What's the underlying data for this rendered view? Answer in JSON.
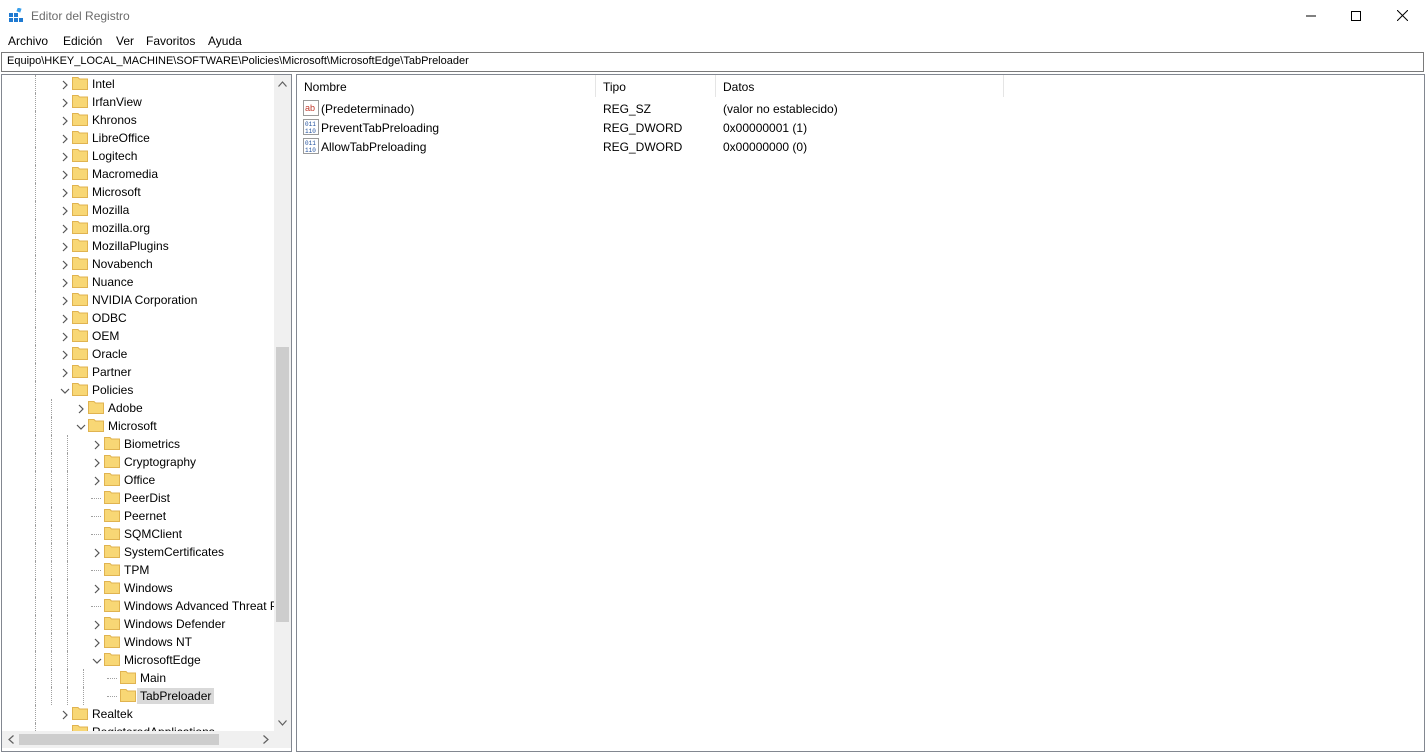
{
  "window": {
    "title": "Editor del Registro",
    "icon": "regedit-icon"
  },
  "menu": {
    "items": [
      "Archivo",
      "Edición",
      "Ver",
      "Favoritos",
      "Ayuda"
    ]
  },
  "address": {
    "path": "Equipo\\HKEY_LOCAL_MACHINE\\SOFTWARE\\Policies\\Microsoft\\MicrosoftEdge\\TabPreloader"
  },
  "tree": {
    "items": [
      {
        "label": "Intel",
        "level": 0,
        "state": "collapsed"
      },
      {
        "label": "IrfanView",
        "level": 0,
        "state": "collapsed"
      },
      {
        "label": "Khronos",
        "level": 0,
        "state": "collapsed"
      },
      {
        "label": "LibreOffice",
        "level": 0,
        "state": "collapsed"
      },
      {
        "label": "Logitech",
        "level": 0,
        "state": "collapsed"
      },
      {
        "label": "Macromedia",
        "level": 0,
        "state": "collapsed"
      },
      {
        "label": "Microsoft",
        "level": 0,
        "state": "collapsed"
      },
      {
        "label": "Mozilla",
        "level": 0,
        "state": "collapsed"
      },
      {
        "label": "mozilla.org",
        "level": 0,
        "state": "collapsed"
      },
      {
        "label": "MozillaPlugins",
        "level": 0,
        "state": "collapsed"
      },
      {
        "label": "Novabench",
        "level": 0,
        "state": "collapsed"
      },
      {
        "label": "Nuance",
        "level": 0,
        "state": "collapsed"
      },
      {
        "label": "NVIDIA Corporation",
        "level": 0,
        "state": "collapsed"
      },
      {
        "label": "ODBC",
        "level": 0,
        "state": "collapsed"
      },
      {
        "label": "OEM",
        "level": 0,
        "state": "collapsed"
      },
      {
        "label": "Oracle",
        "level": 0,
        "state": "collapsed"
      },
      {
        "label": "Partner",
        "level": 0,
        "state": "collapsed"
      },
      {
        "label": "Policies",
        "level": 0,
        "state": "expanded"
      },
      {
        "label": "Adobe",
        "level": 1,
        "state": "collapsed"
      },
      {
        "label": "Microsoft",
        "level": 1,
        "state": "expanded"
      },
      {
        "label": "Biometrics",
        "level": 2,
        "state": "collapsed"
      },
      {
        "label": "Cryptography",
        "level": 2,
        "state": "collapsed"
      },
      {
        "label": "Office",
        "level": 2,
        "state": "collapsed"
      },
      {
        "label": "PeerDist",
        "level": 2,
        "state": "leaf"
      },
      {
        "label": "Peernet",
        "level": 2,
        "state": "leaf"
      },
      {
        "label": "SQMClient",
        "level": 2,
        "state": "leaf"
      },
      {
        "label": "SystemCertificates",
        "level": 2,
        "state": "collapsed"
      },
      {
        "label": "TPM",
        "level": 2,
        "state": "leaf"
      },
      {
        "label": "Windows",
        "level": 2,
        "state": "collapsed"
      },
      {
        "label": "Windows Advanced Threat P",
        "level": 2,
        "state": "leaf"
      },
      {
        "label": "Windows Defender",
        "level": 2,
        "state": "collapsed"
      },
      {
        "label": "Windows NT",
        "level": 2,
        "state": "collapsed"
      },
      {
        "label": "MicrosoftEdge",
        "level": 2,
        "state": "expanded"
      },
      {
        "label": "Main",
        "level": 3,
        "state": "leaf"
      },
      {
        "label": "TabPreloader",
        "level": 3,
        "state": "leaf",
        "selected": true
      },
      {
        "label": "Realtek",
        "level": 0,
        "state": "collapsed"
      },
      {
        "label": "RegisteredApplications",
        "level": 0,
        "state": "leaf"
      }
    ]
  },
  "values": {
    "columns": [
      "Nombre",
      "Tipo",
      "Datos"
    ],
    "rows": [
      {
        "name": "(Predeterminado)",
        "type": "REG_SZ",
        "data": "(valor no establecido)",
        "icon": "string-value-icon"
      },
      {
        "name": "PreventTabPreloading",
        "type": "REG_DWORD",
        "data": "0x00000001 (1)",
        "icon": "binary-value-icon"
      },
      {
        "name": "AllowTabPreloading",
        "type": "REG_DWORD",
        "data": "0x00000000 (0)",
        "icon": "binary-value-icon"
      }
    ]
  },
  "colors": {
    "folder": "#f8d775",
    "folder_dark": "#e0b350",
    "selection": "#d9d9d9",
    "scroll_thumb": "#cdcdcd"
  }
}
